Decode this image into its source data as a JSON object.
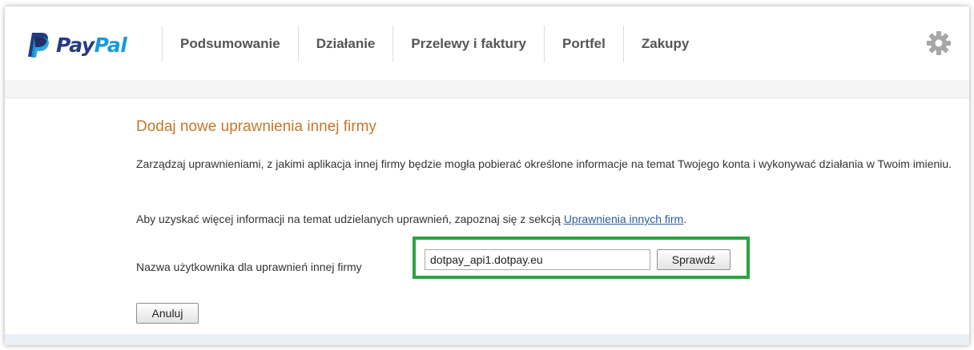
{
  "brand": {
    "name_part1": "Pay",
    "name_part2": "Pal",
    "colors": {
      "dark_blue": "#253b80",
      "light_blue": "#179bd7"
    }
  },
  "nav": {
    "items": [
      {
        "label": "Podsumowanie"
      },
      {
        "label": "Działanie"
      },
      {
        "label": "Przelewy i faktury"
      },
      {
        "label": "Portfel"
      },
      {
        "label": "Zakupy"
      }
    ],
    "settings_icon": "gear-icon"
  },
  "main": {
    "title": "Dodaj nowe uprawnienia innej firmy",
    "description": "Zarządzaj uprawnieniami, z jakimi aplikacja innej firmy będzie mogła pobierać określone informacje na temat Twojego konta i wykonywać działania w Twoim imieniu.",
    "info_prefix": "Aby uzyskać więcej informacji na temat udzielanych uprawnień, zapoznaj się z sekcją ",
    "info_link": "Uprawnienia innych firm",
    "info_suffix": ".",
    "username_label": "Nazwa użytkownika dla uprawnień innej firmy",
    "username_value": "dotpay_api1.dotpay.eu",
    "check_button": "Sprawdź",
    "cancel_button": "Anuluj"
  },
  "colors": {
    "title": "#c5772b",
    "highlight": "#2aa341",
    "link": "#2a5c9a"
  }
}
